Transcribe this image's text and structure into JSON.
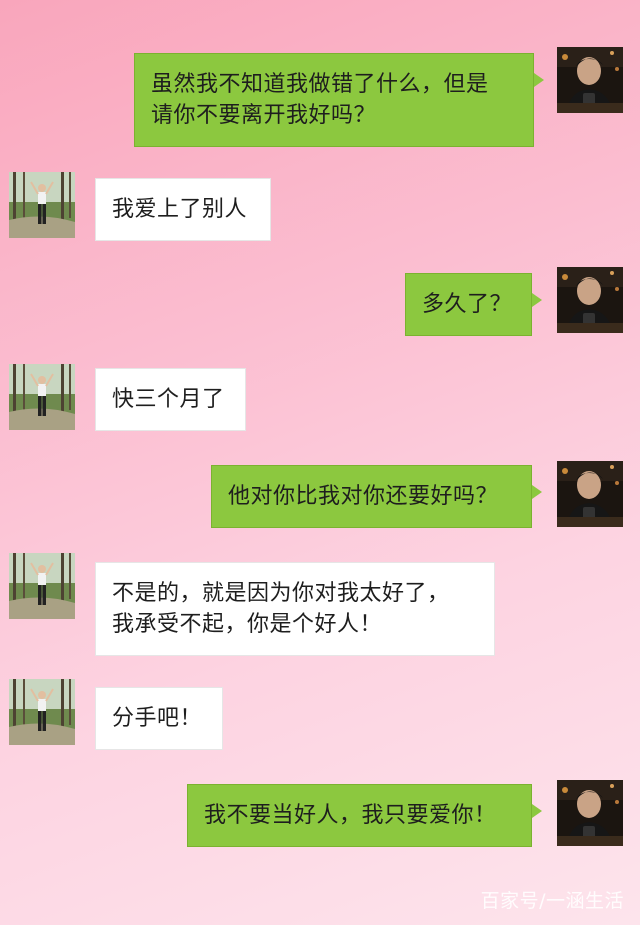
{
  "messages": [
    {
      "side": "me",
      "text": [
        "虽然我不知道我做错了什么，但是",
        "请你不要离开我好吗？"
      ]
    },
    {
      "side": "her",
      "text": [
        "我爱上了别人"
      ]
    },
    {
      "side": "me",
      "text": [
        "多久了？"
      ]
    },
    {
      "side": "her",
      "text": [
        "快三个月了"
      ]
    },
    {
      "side": "me",
      "text": [
        "他对你比我对你还要好吗？"
      ]
    },
    {
      "side": "her",
      "text": [
        "不是的，就是因为你对我太好了，",
        "我承受不起，你是个好人！"
      ]
    },
    {
      "side": "her",
      "text": [
        "分手吧！"
      ]
    },
    {
      "side": "me",
      "text": [
        "我不要当好人，我只要爱你！"
      ]
    }
  ],
  "avatars": {
    "me": {
      "icon": "man-portrait-avatar-icon"
    },
    "her": {
      "icon": "woman-in-forest-avatar-icon"
    }
  },
  "colors": {
    "my_bubble": "#8cc83f",
    "her_bubble": "#ffffff",
    "background_top": "#f9a6bc",
    "background_bottom": "#fde4ec"
  },
  "watermark": "百家号/一涵生活"
}
